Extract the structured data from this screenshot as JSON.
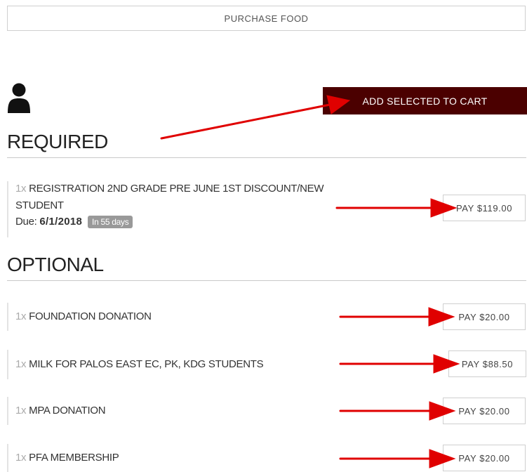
{
  "header": {
    "purchase_food_label": "PURCHASE FOOD"
  },
  "toolbar": {
    "add_to_cart_label": "ADD SELECTED TO CART"
  },
  "required": {
    "title": "REQUIRED",
    "items": [
      {
        "qty": "1x",
        "name_line1": "REGISTRATION 2ND GRADE PRE JUNE 1ST DISCOUNT/NEW",
        "name_line2": "STUDENT",
        "due_label": "Due:",
        "due_date": "6/1/2018",
        "badge": "In 55 days",
        "pay_label": "PAY $119.00"
      }
    ]
  },
  "optional": {
    "title": "OPTIONAL",
    "items": [
      {
        "qty": "1x",
        "name": "FOUNDATION DONATION",
        "pay_label": "PAY $20.00"
      },
      {
        "qty": "1x",
        "name": "MILK FOR PALOS EAST EC, PK, KDG STUDENTS",
        "pay_label": "PAY $88.50"
      },
      {
        "qty": "1x",
        "name": "MPA DONATION",
        "pay_label": "PAY $20.00"
      },
      {
        "qty": "1x",
        "name": "PFA MEMBERSHIP",
        "pay_label": "PAY $20.00"
      }
    ]
  },
  "colors": {
    "accent_dark_red": "#4b0000",
    "annotation_arrow": "#e00000"
  },
  "icons": {
    "user": "user-icon",
    "annotation": "arrow-annotation"
  }
}
